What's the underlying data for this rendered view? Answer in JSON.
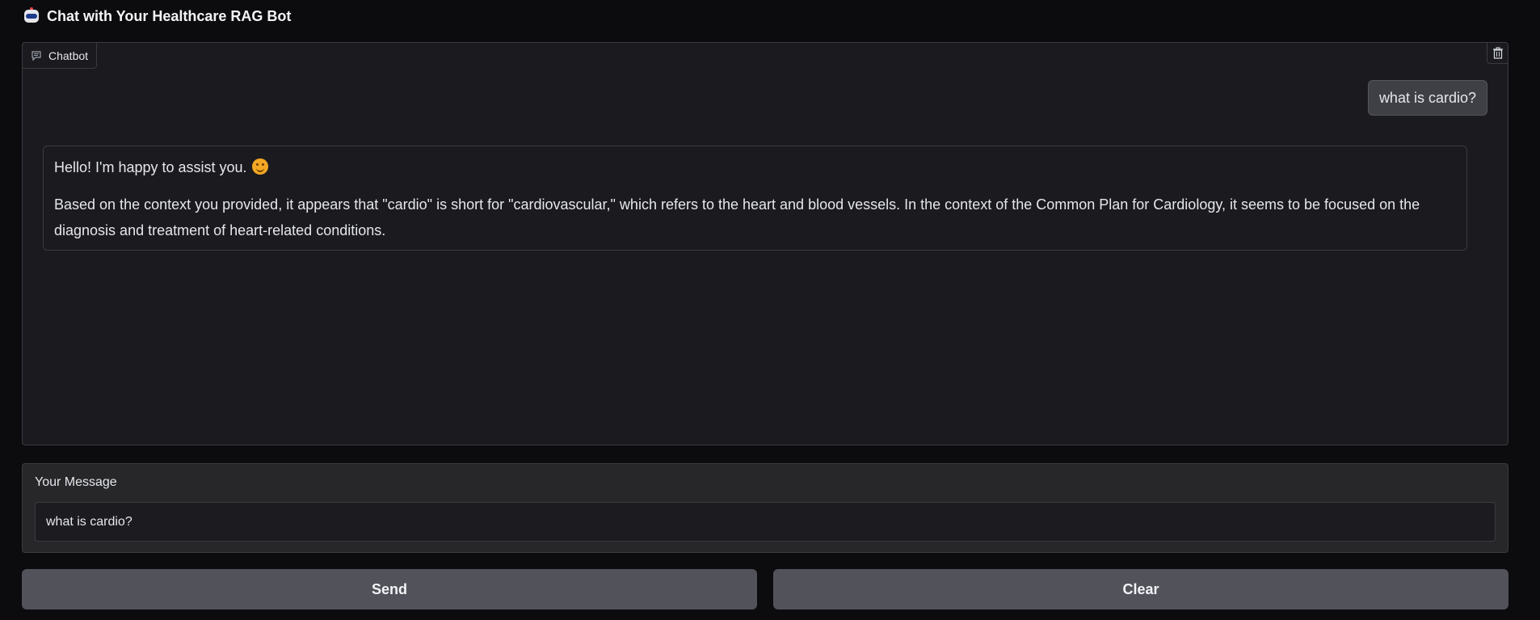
{
  "header": {
    "title": "Chat with Your Healthcare RAG Bot",
    "icon": "robot-icon"
  },
  "chatbot": {
    "tab_label": "Chatbot",
    "tab_icon": "chat-bubble-icon",
    "clear_icon": "trash-icon",
    "messages": [
      {
        "role": "user",
        "text": "what is cardio?"
      },
      {
        "role": "bot",
        "paragraphs": [
          "Hello! I'm happy to assist you.",
          "Based on the context you provided, it appears that \"cardio\" is short for \"cardiovascular,\" which refers to the heart and blood vessels. In the context of the Common Plan for Cardiology, it seems to be focused on the diagnosis and treatment of heart-related conditions."
        ],
        "emoji": "smiling-face-icon"
      }
    ]
  },
  "input": {
    "label": "Your Message",
    "value": "what is cardio?"
  },
  "buttons": {
    "send": "Send",
    "clear": "Clear"
  },
  "colors": {
    "background": "#0c0c0f",
    "panel": "#1b1b1f",
    "input_panel": "#27272a",
    "button": "#52525b",
    "text": "#e5e7eb"
  }
}
